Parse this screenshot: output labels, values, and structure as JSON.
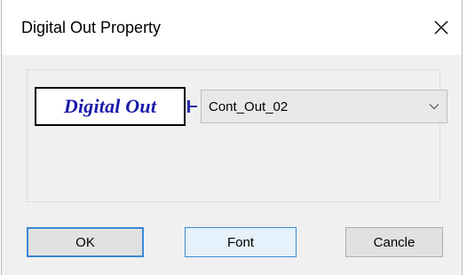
{
  "window": {
    "title": "Digital Out Property",
    "close_glyph": "✕"
  },
  "preview": {
    "label": "Digital Out",
    "label_color": "#1a1aa8"
  },
  "combo": {
    "selected": "Cont_Out_02",
    "icon": "chevron-down-icon"
  },
  "buttons": {
    "ok_label": "OK",
    "font_label": "Font",
    "cancel_label": "Cancle"
  },
  "colors": {
    "accent": "#3c88d6"
  }
}
